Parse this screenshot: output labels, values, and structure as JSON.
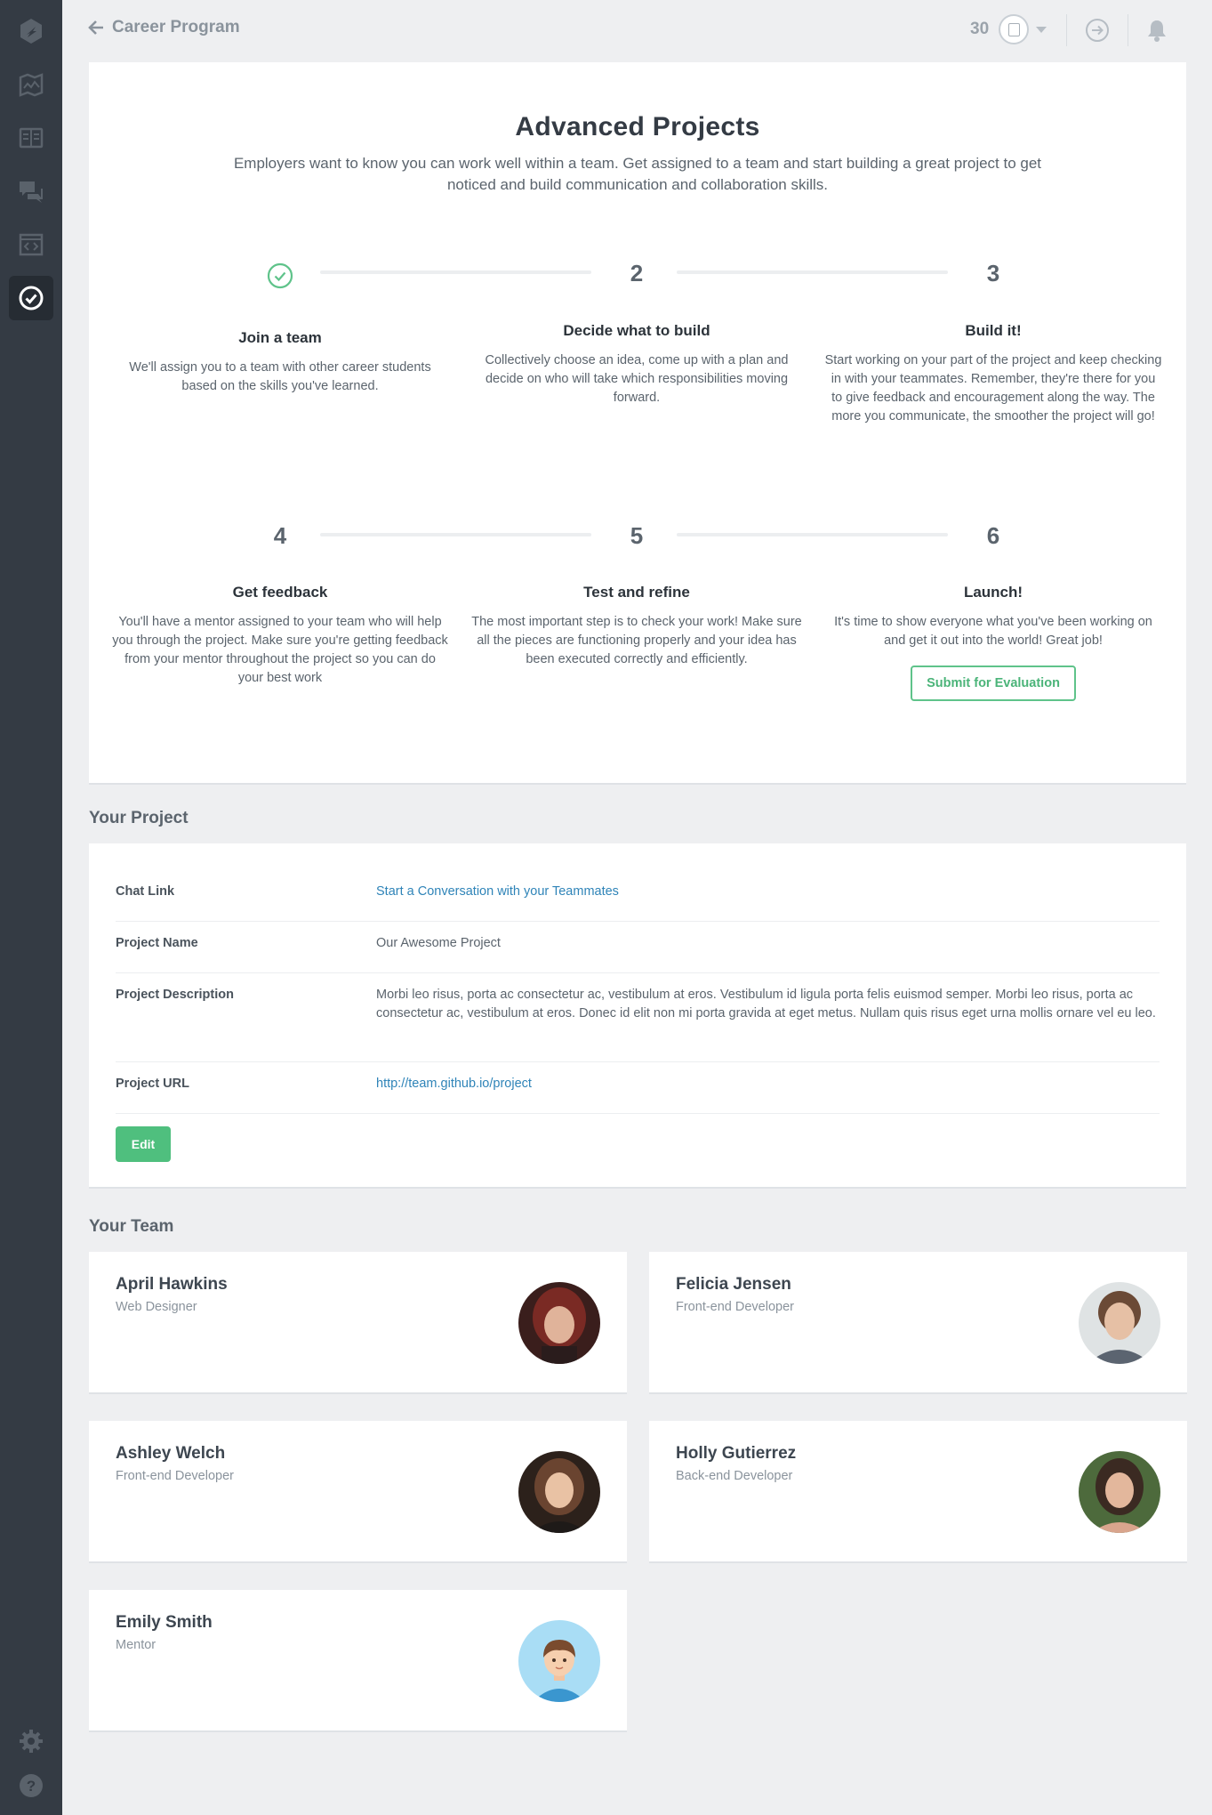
{
  "topbar": {
    "back_label": "Career Program",
    "points": "30"
  },
  "hero": {
    "title": "Advanced Projects",
    "subtitle": "Employers want to know you can work well within a team. Get assigned to a team and start building a great project to get noticed and build communication and collaboration skills.",
    "steps": [
      {
        "num": "",
        "completed": true,
        "title": "Join a team",
        "desc": "We'll assign you to a team with other career students based on the skills you've learned."
      },
      {
        "num": "2",
        "title": "Decide what to build",
        "desc": "Collectively choose an idea, come up with a plan and decide on who will take which responsibilities moving forward."
      },
      {
        "num": "3",
        "title": "Build it!",
        "desc": "Start working on your part of the project and keep checking in with your teammates. Remember, they're there for you to give feedback and encouragement along the way. The more you communicate, the smoother the project will go!"
      },
      {
        "num": "4",
        "title": "Get feedback",
        "desc": "You'll have a mentor assigned to your team who will help you through the project. Make sure you're getting feedback from your mentor throughout the project so you can do your best work"
      },
      {
        "num": "5",
        "title": "Test and refine",
        "desc": "The most important step is to check your work! Make sure all the pieces are functioning properly and your idea has been executed correctly and efficiently."
      },
      {
        "num": "6",
        "title": "Launch!",
        "desc": "It's time to show everyone what you've been working on and get it out into the world! Great job!"
      }
    ],
    "submit_label": "Submit for Evaluation"
  },
  "project": {
    "section_title": "Your Project",
    "rows": [
      {
        "label": "Chat Link",
        "value": "Start a Conversation with your Teammates"
      },
      {
        "label": "Project Name",
        "value": "Our Awesome Project"
      },
      {
        "label": "Project Description",
        "value": "Morbi leo risus, porta ac consectetur ac, vestibulum at eros. Vestibulum id ligula porta felis euismod semper. Morbi leo risus, porta ac consectetur ac, vestibulum at eros. Donec id elit non mi porta gravida at eget metus. Nullam quis risus eget urna mollis ornare vel eu leo."
      },
      {
        "label": "Project URL",
        "value": "http://team.github.io/project"
      }
    ],
    "edit_label": "Edit"
  },
  "team": {
    "section_title": "Your Team",
    "members": [
      {
        "name": "April Hawkins",
        "role": "Web Designer"
      },
      {
        "name": "Felicia Jensen",
        "role": "Front-end Developer"
      },
      {
        "name": "Ashley Welch",
        "role": "Front-end Developer"
      },
      {
        "name": "Holly Gutierrez",
        "role": "Back-end Developer"
      },
      {
        "name": "Emily Smith",
        "role": "Mentor"
      }
    ]
  },
  "colors": {
    "sidebar": "#343b44",
    "accent_green": "#4fbf7e",
    "link_blue": "#2f84b8",
    "background": "#eeeff1"
  },
  "icons": {
    "sidebar": [
      "logo-icon",
      "map-icon",
      "book-icon",
      "chat-icon",
      "code-icon",
      "check-circle-icon",
      "gear-icon",
      "help-icon"
    ],
    "topbar": [
      "arrow-left-icon",
      "arrow-right-circle-icon",
      "bell-icon"
    ]
  }
}
